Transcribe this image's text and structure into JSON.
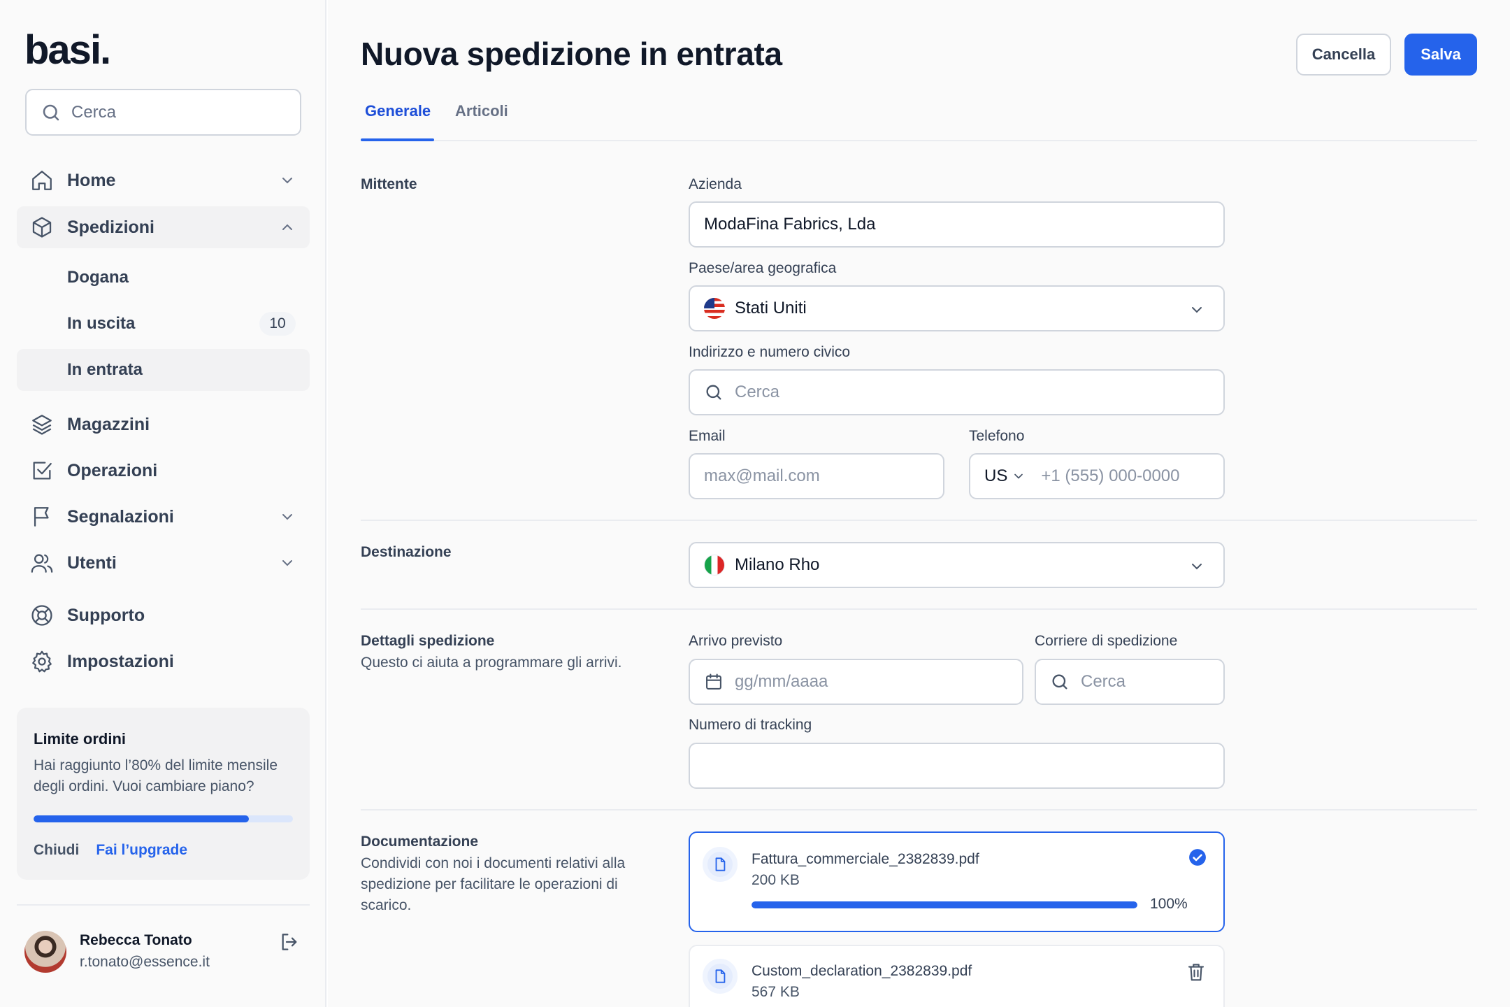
{
  "app": {
    "logo": "basi."
  },
  "sidebar": {
    "search_placeholder": "Cerca",
    "nav": {
      "home": "Home",
      "spedizioni": "Spedizioni",
      "dogana": "Dogana",
      "in_uscita": "In uscita",
      "in_uscita_count": "10",
      "in_entrata": "In entrata",
      "magazzini": "Magazzini",
      "operazioni": "Operazioni",
      "segnalazioni": "Segnalazioni",
      "utenti": "Utenti",
      "supporto": "Supporto",
      "impostazioni": "Impostazioni"
    },
    "limit_card": {
      "title": "Limite ordini",
      "description": "Hai raggiunto l’80% del limite mensile degli ordini. Vuoi cambiare piano?",
      "progress_fraction": 0.83,
      "close_label": "Chiudi",
      "upgrade_label": "Fai l’upgrade"
    },
    "user": {
      "name": "Rebecca Tonato",
      "email": "r.tonato@essence.it"
    }
  },
  "header": {
    "title": "Nuova spedizione in entrata",
    "cancel_label": "Cancella",
    "save_label": "Salva"
  },
  "tabs": [
    {
      "label": "Generale",
      "active": true
    },
    {
      "label": "Articoli",
      "active": false
    }
  ],
  "sections": {
    "mittente": {
      "title": "Mittente",
      "company_label": "Azienda",
      "company_value": "ModaFina Fabrics, Lda",
      "country_label": "Paese/area geografica",
      "country_value": "Stati Uniti",
      "address_label": "Indirizzo e numero civico",
      "address_placeholder": "Cerca",
      "email_label": "Email",
      "email_placeholder": "max@mail.com",
      "phone_label": "Telefono",
      "phone_country": "US",
      "phone_placeholder": "+1 (555) 000-0000"
    },
    "destinazione": {
      "title": "Destinazione",
      "value": "Milano Rho"
    },
    "dettagli": {
      "title": "Dettagli spedizione",
      "description": "Questo ci aiuta a programmare gli arrivi.",
      "arrival_label": "Arrivo previsto",
      "arrival_placeholder": "gg/mm/aaaa",
      "carrier_label": "Corriere di spedizione",
      "carrier_placeholder": "Cerca",
      "tracking_label": "Numero di tracking",
      "tracking_value": ""
    },
    "documentazione": {
      "title": "Documentazione",
      "description": "Condividi con noi i documenti relativi alla spedizione per facilitare le operazioni di scarico.",
      "files": [
        {
          "name": "Fattura_commerciale_2382839.pdf",
          "size": "200 KB",
          "progress_percent": 100,
          "progress_label": "100%",
          "status": "complete"
        },
        {
          "name": "Custom_declaration_2382839.pdf",
          "size": "567 KB",
          "status": "uploaded"
        }
      ]
    }
  },
  "colors": {
    "accent": "#2563eb",
    "border": "#d0d5dd",
    "text": "#101828",
    "muted": "#475467",
    "background": "#fafafa"
  },
  "icons": [
    "search-icon",
    "home-icon",
    "box-icon",
    "layers-icon",
    "check-square-icon",
    "flag-icon",
    "users-icon",
    "lifebuoy-icon",
    "gear-icon",
    "logout-icon",
    "calendar-icon",
    "file-icon",
    "check-circle-icon",
    "trash-icon",
    "chevron-down-icon",
    "chevron-up-icon"
  ]
}
